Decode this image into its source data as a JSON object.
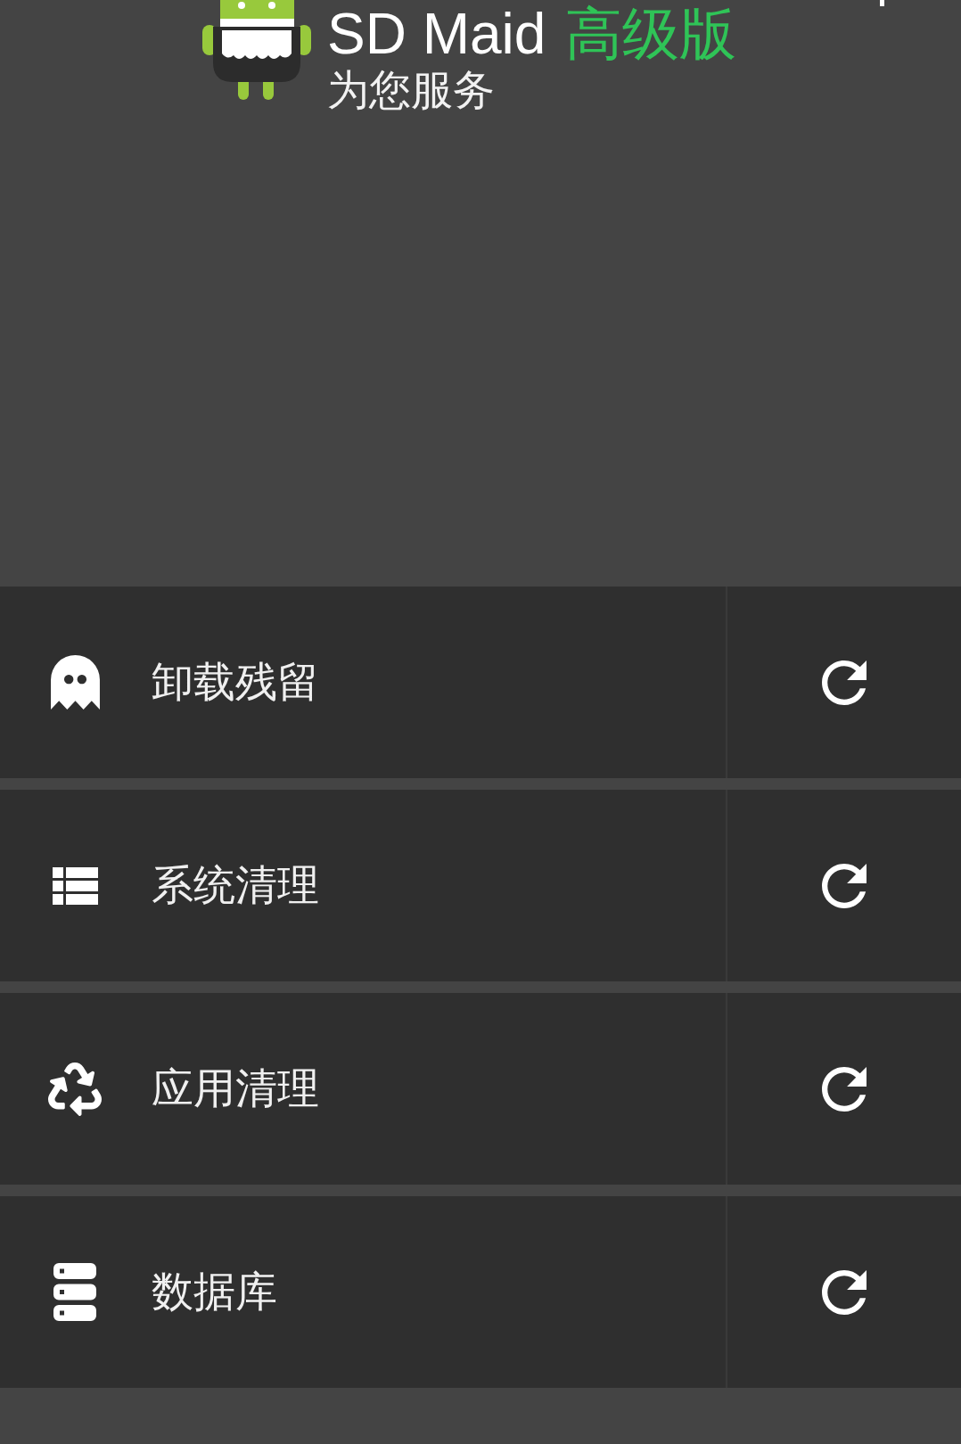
{
  "header": {
    "app_name": "SD Maid",
    "edition": "高级版",
    "tagline": "为您服务"
  },
  "tools": [
    {
      "kind": "ghost",
      "label": "卸载残留"
    },
    {
      "kind": "list",
      "label": "系统清理"
    },
    {
      "kind": "recycle",
      "label": "应用清理"
    },
    {
      "kind": "database",
      "label": "数据库"
    }
  ]
}
